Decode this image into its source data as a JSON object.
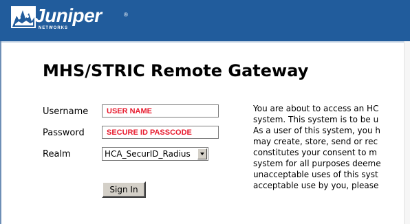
{
  "header": {
    "logo_text": "Juniper",
    "logo_registered": "®",
    "logo_subtext": "NETWORKS",
    "background_color": "#215c9c"
  },
  "page_title": "MHS/STRIC Remote Gateway",
  "login": {
    "username": {
      "label": "Username",
      "value": "USER NAME"
    },
    "password": {
      "label": "Password",
      "value": "SECURE ID PASSCODE"
    },
    "realm": {
      "label": "Realm",
      "selected": "HCA_SecurID_Radius"
    },
    "sign_in_label": "Sign In",
    "field_text_color": "#e8192c"
  },
  "notice": {
    "lines": [
      "You are about to access an HC",
      "system. This system is to be u",
      "As a user of this system, you h",
      "may create, store, send or rec",
      "constitutes your consent to m",
      "system for all purposes deeme",
      "unacceptable uses of this syst",
      "acceptable use by you, please"
    ]
  }
}
